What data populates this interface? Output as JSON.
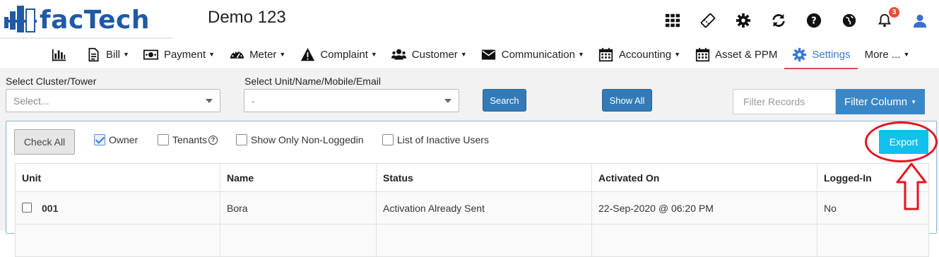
{
  "header": {
    "logo_text": "facTech",
    "app_title": "Demo 123",
    "icons": [
      "apps-grid-icon",
      "ticket-icon",
      "gear-icon",
      "refresh-icon",
      "help-circle-icon",
      "globe-icon",
      "bell-icon",
      "user-icon"
    ],
    "notification_count": "3"
  },
  "nav": {
    "items": [
      {
        "label": "",
        "icon": "bar-chart-icon"
      },
      {
        "label": "Bill",
        "icon": "document-icon"
      },
      {
        "label": "Payment",
        "icon": "money-icon"
      },
      {
        "label": "Meter",
        "icon": "gauge-icon"
      },
      {
        "label": "Complaint",
        "icon": "warning-icon"
      },
      {
        "label": "Customer",
        "icon": "users-icon"
      },
      {
        "label": "Communication",
        "icon": "envelope-icon"
      },
      {
        "label": "Accounting",
        "icon": "calendar-icon"
      },
      {
        "label": "Asset & PPM",
        "icon": "calendar-icon"
      },
      {
        "label": "Settings",
        "icon": "gear-icon"
      },
      {
        "label": "More ...",
        "icon": ""
      }
    ],
    "active": "Settings"
  },
  "filters": {
    "cluster_label": "Select Cluster/Tower",
    "cluster_placeholder": "Select...",
    "unit_label": "Select Unit/Name/Mobile/Email",
    "unit_value": "-",
    "search_button": "Search",
    "show_all_button": "Show All",
    "filter_records_placeholder": "Filter Records",
    "filter_column_button": "Filter Column"
  },
  "panel": {
    "check_all": "Check All",
    "checkboxes": [
      {
        "label": "Owner",
        "checked": true
      },
      {
        "label": "Tenants",
        "checked": false
      },
      {
        "label": "Show Only Non-Loggedin",
        "checked": false
      },
      {
        "label": "List of Inactive Users",
        "checked": false
      }
    ],
    "export_button": "Export"
  },
  "table": {
    "headers": [
      "Unit",
      "Name",
      "Status",
      "Activated On",
      "Logged-In"
    ],
    "rows": [
      {
        "unit": "001",
        "name": "Bora",
        "status": "Activation Already Sent",
        "activated_on": "22-Sep-2020 @ 06:20 PM",
        "logged_in": "No"
      }
    ]
  },
  "colors": {
    "brand": "#1f5aa6",
    "active_nav": "#3a7bd5",
    "active_underline": "#e0485a",
    "primary_button": "#337ab7",
    "export_button": "#12c0ee",
    "annotation": "#e3141f"
  }
}
